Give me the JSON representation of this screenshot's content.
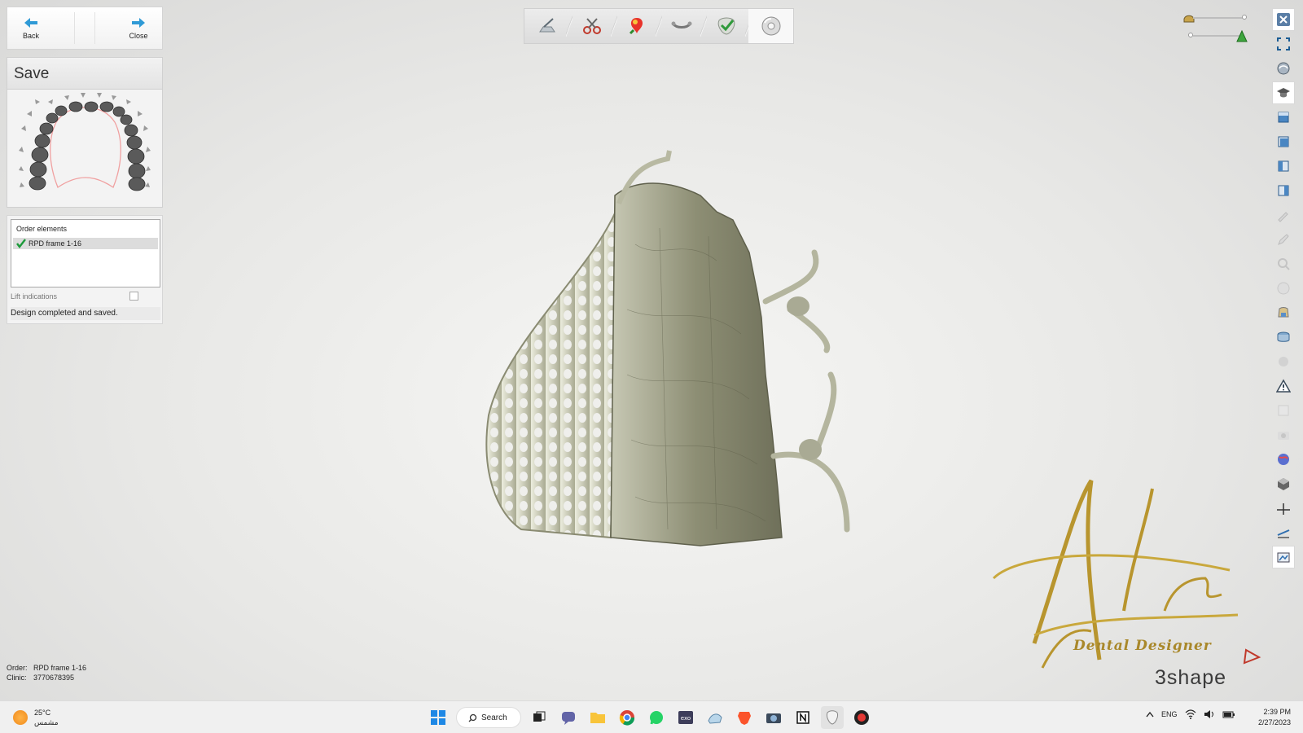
{
  "nav": {
    "back_label": "Back",
    "close_label": "Close"
  },
  "panel": {
    "title": "Save",
    "order_elements_header": "Order elements",
    "order_items": [
      {
        "label": "RPD frame 1-16",
        "checked": true
      }
    ],
    "lift_indications_label": "Lift indications",
    "lift_indications_checked": false,
    "status": "Design completed and saved."
  },
  "order_info": {
    "order_label": "Order:",
    "order_value": "RPD frame 1-16",
    "clinic_label": "Clinic:",
    "clinic_value": "3770678395"
  },
  "toolbar": {
    "tools": [
      {
        "icon": "scanner-icon"
      },
      {
        "icon": "scissors-icon"
      },
      {
        "icon": "wax-knife-icon"
      },
      {
        "icon": "connector-icon"
      },
      {
        "icon": "check-tooth-icon"
      },
      {
        "icon": "disc-save-icon",
        "active": true
      }
    ]
  },
  "right_toolbar": {
    "icons": [
      "close-icon",
      "fullscreen-icon",
      "view-rotate-icon",
      "graduation-cap-icon",
      "view-front-icon",
      "view-back-icon",
      "view-left-icon",
      "view-right-icon",
      "brush-icon",
      "pencil-icon",
      "magnify-icon",
      "sphere-icon",
      "tooth-profile-icon",
      "layers-icon",
      "sphere-dim-icon",
      "warning-icon",
      "clipping-icon",
      "camera-icon",
      "color-map-icon",
      "cube-icon",
      "section-icon",
      "measure-icon",
      "snapshot-icon"
    ]
  },
  "logo": {
    "signature_text": "Dental Designer",
    "brand_text": "3shape"
  },
  "taskbar": {
    "temperature": "25°C",
    "weather_desc": "مشمس",
    "search_label": "Search",
    "language": "ENG",
    "time": "2:39 PM",
    "date": "2/27/2023"
  },
  "colors": {
    "model": "#8a8a72",
    "accent_blue": "#2f9ad6",
    "gold": "#b8952e"
  }
}
